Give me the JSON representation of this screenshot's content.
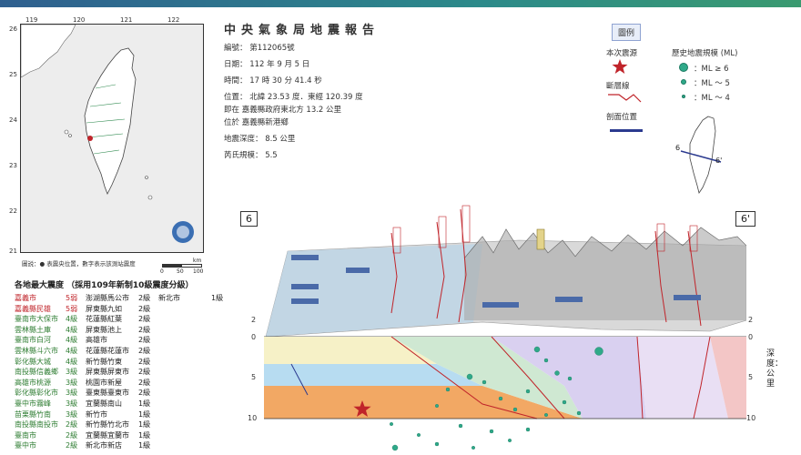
{
  "report": {
    "title": "中央氣象局地震報告",
    "number": "編號： 第112065號",
    "date": "日期： 112 年 9 月 5 日",
    "time": "時間： 17 時 30 分 41.4 秒",
    "position": "位置： 北緯 23.53 度．東經 120.39 度",
    "offset": "即在 嘉義縣政府東北方 13.2 公里",
    "located": "位於 嘉義縣新港鄉",
    "depth": "地震深度： 8.5 公里",
    "magnitude": "芮氏規模： 5.5"
  },
  "legend": {
    "title": "圖例",
    "epicenter": "本次震源",
    "fault": "斷層線",
    "profile": "剖面位置",
    "history_title": "歷史地震規模 (ML)",
    "ml6": "：ML ≥ 6",
    "ml5": "：ML ～ 5",
    "ml4": "：ML ～ 4",
    "profile_a": "6",
    "profile_b": "6'"
  },
  "map": {
    "lon_ticks": [
      "119",
      "120",
      "121",
      "122"
    ],
    "lat_ticks": [
      "26",
      "25",
      "24",
      "23",
      "22",
      "21"
    ],
    "legend_text": "圖説：● 表震央位置，數字表示該測站震度",
    "scale_0": "0",
    "scale_50": "50",
    "scale_100": "100",
    "scale_unit": "km"
  },
  "intensity": {
    "title": "各地最大震度 （採用109年新制10級震度分級）",
    "rows": [
      {
        "a": "嘉義市",
        "ai": "5弱",
        "ac": "r",
        "b": "澎湖縣馬公市",
        "bi": "2級",
        "c": "新北市",
        "ci": "1級"
      },
      {
        "a": "嘉義縣民雄",
        "ai": "5弱",
        "ac": "r",
        "b": "屏東縣九如",
        "bi": "2級",
        "c": "",
        "ci": ""
      },
      {
        "a": "臺南市大保市",
        "ai": "4級",
        "ac": "g",
        "b": "花蓮縣紅葉",
        "bi": "2級",
        "c": "",
        "ci": ""
      },
      {
        "a": "雲林縣土庫",
        "ai": "4級",
        "ac": "g",
        "b": "屏東縣池上",
        "bi": "2級",
        "c": "",
        "ci": ""
      },
      {
        "a": "臺南市白河",
        "ai": "4級",
        "ac": "g",
        "b": "高雄市",
        "bi": "2級",
        "c": "",
        "ci": ""
      },
      {
        "a": "雲林縣斗六市",
        "ai": "4級",
        "ac": "g",
        "b": "花蓮縣花蓮市",
        "bi": "2級",
        "c": "",
        "ci": ""
      },
      {
        "a": "彰化縣大城",
        "ai": "4級",
        "ac": "g",
        "b": "新竹縣竹東",
        "bi": "2級",
        "c": "",
        "ci": ""
      },
      {
        "a": "南投縣信義鄉",
        "ai": "3級",
        "ac": "g",
        "b": "屏東縣屏東市",
        "bi": "2級",
        "c": "",
        "ci": ""
      },
      {
        "a": "高雄市桃源",
        "ai": "3級",
        "ac": "g",
        "b": "桃園市新屋",
        "bi": "2級",
        "c": "",
        "ci": ""
      },
      {
        "a": "彰化縣彰化市",
        "ai": "3級",
        "ac": "g",
        "b": "臺東縣臺東市",
        "bi": "2級",
        "c": "",
        "ci": ""
      },
      {
        "a": "臺中市霧峰",
        "ai": "3級",
        "ac": "g",
        "b": "宜蘭縣南山",
        "bi": "1級",
        "c": "",
        "ci": ""
      },
      {
        "a": "苗栗縣竹南",
        "ai": "3級",
        "ac": "g",
        "b": "新竹市",
        "bi": "1級",
        "c": "",
        "ci": ""
      },
      {
        "a": "南投縣南投市",
        "ai": "2級",
        "ac": "g",
        "b": "新竹縣竹北市",
        "bi": "1級",
        "c": "",
        "ci": ""
      },
      {
        "a": "臺南市",
        "ai": "2級",
        "ac": "g",
        "b": "宜蘭縣宜蘭市",
        "bi": "1級",
        "c": "",
        "ci": ""
      },
      {
        "a": "臺中市",
        "ai": "2級",
        "ac": "g",
        "b": "新北市新店",
        "bi": "1級",
        "c": "",
        "ci": ""
      }
    ]
  },
  "profile": {
    "left_label": "6",
    "right_label": "6'",
    "axis_left": [
      "2",
      "0",
      "5",
      "10"
    ],
    "axis_right": [
      "2",
      "0",
      "5",
      "10"
    ],
    "depth_label": "深度：公里"
  }
}
